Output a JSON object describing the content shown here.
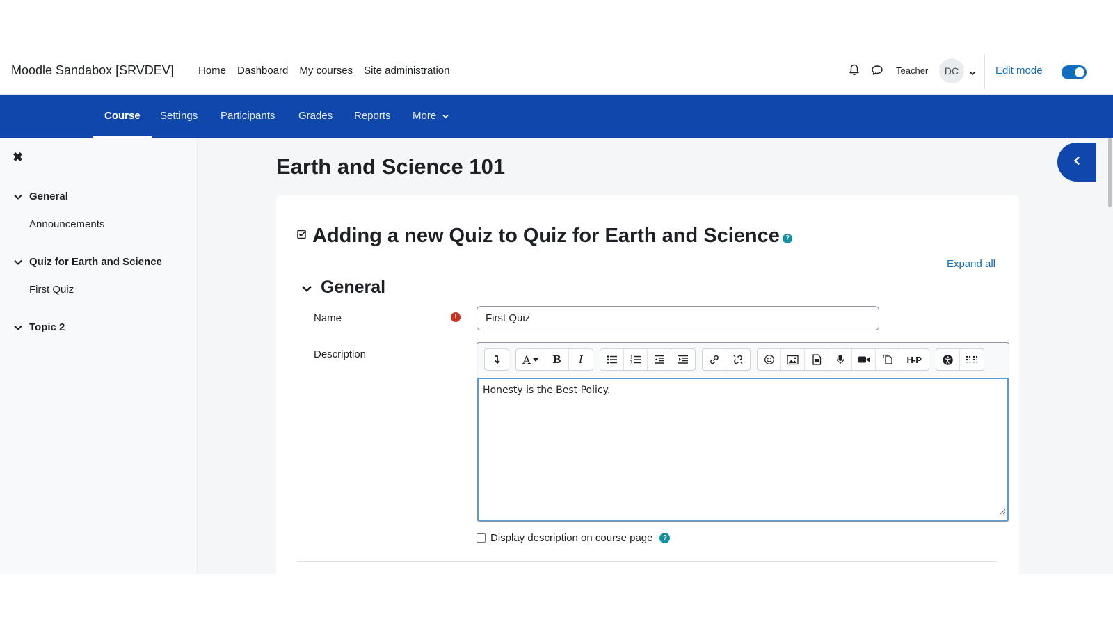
{
  "header": {
    "site_name": "Moodle Sandabox [SRVDEV]",
    "nav": [
      "Home",
      "Dashboard",
      "My courses",
      "Site administration"
    ],
    "user_name": "Teacher",
    "avatar_initials": "DC",
    "edit_mode_label": "Edit mode",
    "edit_mode_on": true
  },
  "secondary_nav": {
    "tabs": [
      {
        "label": "Course",
        "active": true
      },
      {
        "label": "Settings",
        "active": false
      },
      {
        "label": "Participants",
        "active": false
      },
      {
        "label": "Grades",
        "active": false
      },
      {
        "label": "Reports",
        "active": false
      },
      {
        "label": "More",
        "active": false
      }
    ]
  },
  "course_index": {
    "sections": [
      {
        "title": "General",
        "items": [
          "Announcements"
        ]
      },
      {
        "title": "Quiz for Earth and Science",
        "items": [
          "First Quiz"
        ]
      },
      {
        "title": "Topic 2",
        "items": []
      }
    ]
  },
  "main": {
    "course_title": "Earth and Science 101",
    "form_title": "Adding a new Quiz to Quiz for Earth and Science",
    "expand_all": "Expand all",
    "section_title": "General",
    "name_label": "Name",
    "name_value": "First Quiz",
    "description_label": "Description",
    "description_text": "Honesty is the Best Policy.",
    "display_description_label": "Display description on course page",
    "display_description_checked": false
  },
  "colors": {
    "brand_blue": "#0f47ad",
    "link_blue": "#0f6cbf",
    "required_red": "#ca3120",
    "help_teal": "#0f8fa0"
  }
}
